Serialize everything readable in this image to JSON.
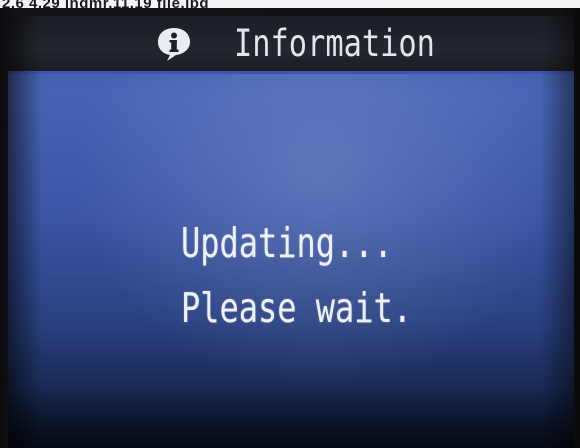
{
  "photo_caption": "2.6 4.29 ingmr.11.19 file.jpg",
  "header": {
    "icon": "info-icon",
    "title": "Information"
  },
  "message": {
    "line1": "Updating...",
    "line2": "Please wait."
  },
  "colors": {
    "screen_blue": "#3e5aa8",
    "header_dark": "#1f2128",
    "header_rule": "#3c55b0",
    "text": "#eef2f8"
  }
}
